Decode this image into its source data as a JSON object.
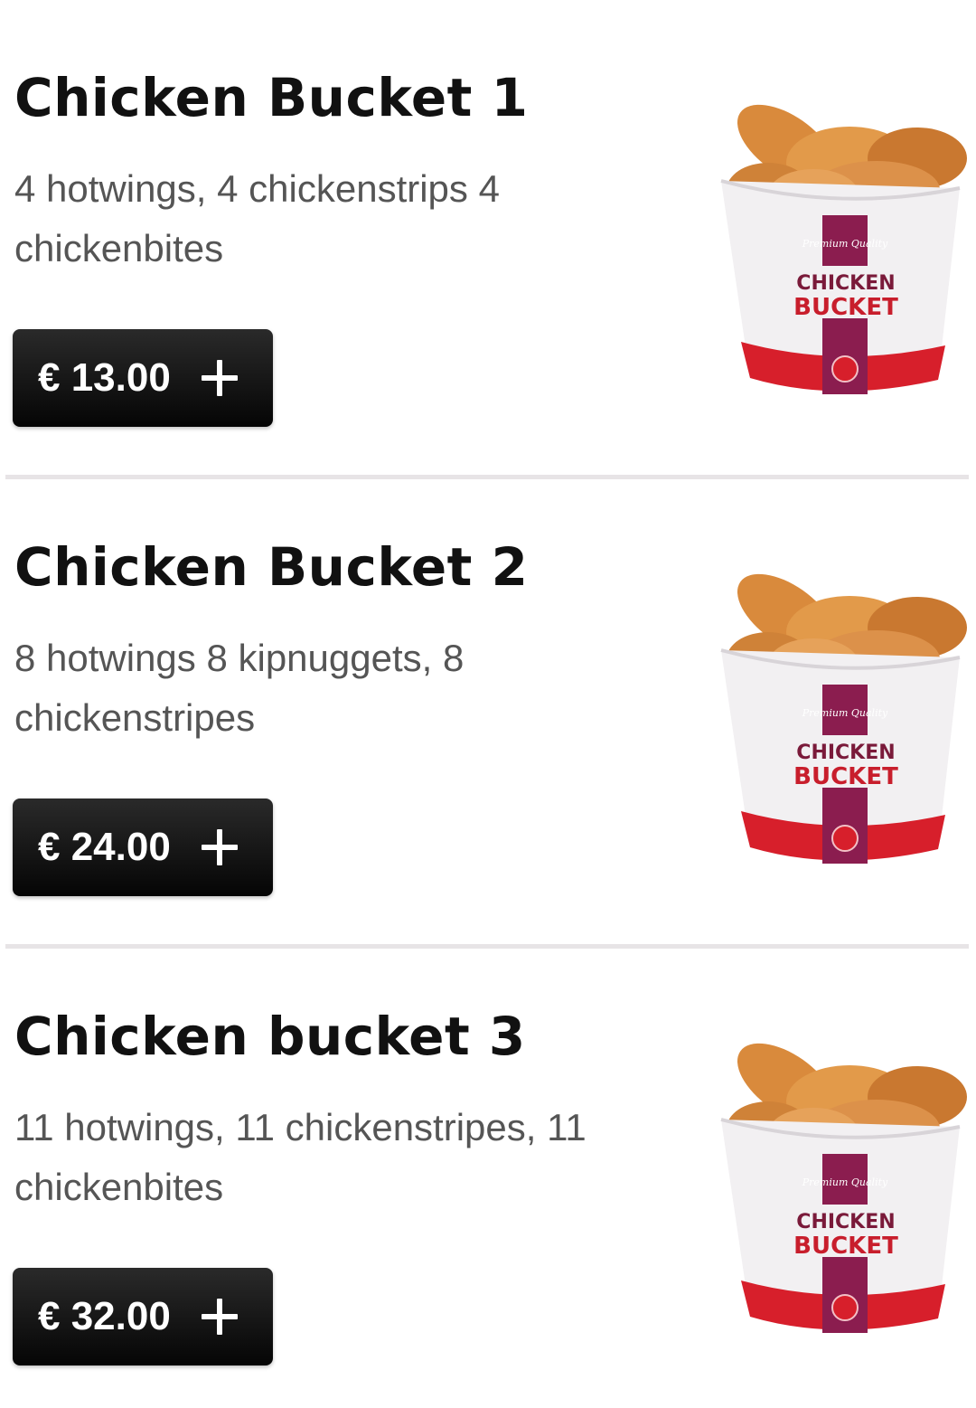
{
  "menu": {
    "items": [
      {
        "title": "Chicken Bucket 1",
        "description": "4 hotwings, 4 chickenstrips 4 chickenbites",
        "price": "€ 13.00",
        "image_label_top": "CHICKEN",
        "image_label_bottom": "BUCKET",
        "image_script": "Premium Quality"
      },
      {
        "title": "Chicken Bucket 2",
        "description": "8 hotwings 8 kipnuggets, 8 chickenstripes",
        "price": "€ 24.00",
        "image_label_top": "CHICKEN",
        "image_label_bottom": "BUCKET",
        "image_script": "Premium Quality"
      },
      {
        "title": "Chicken bucket 3",
        "description": "11 hotwings, 11 chickenstripes, 11 chickenbites",
        "price": "€ 32.00",
        "image_label_top": "CHICKEN",
        "image_label_bottom": "BUCKET",
        "image_script": "Premium Quality"
      }
    ]
  },
  "icons": {
    "add": "plus-icon"
  },
  "colors": {
    "button_bg": "#111111",
    "bucket_red": "#d71f2b",
    "bucket_band": "#8b1d4f",
    "chicken": "#d98a3c"
  }
}
